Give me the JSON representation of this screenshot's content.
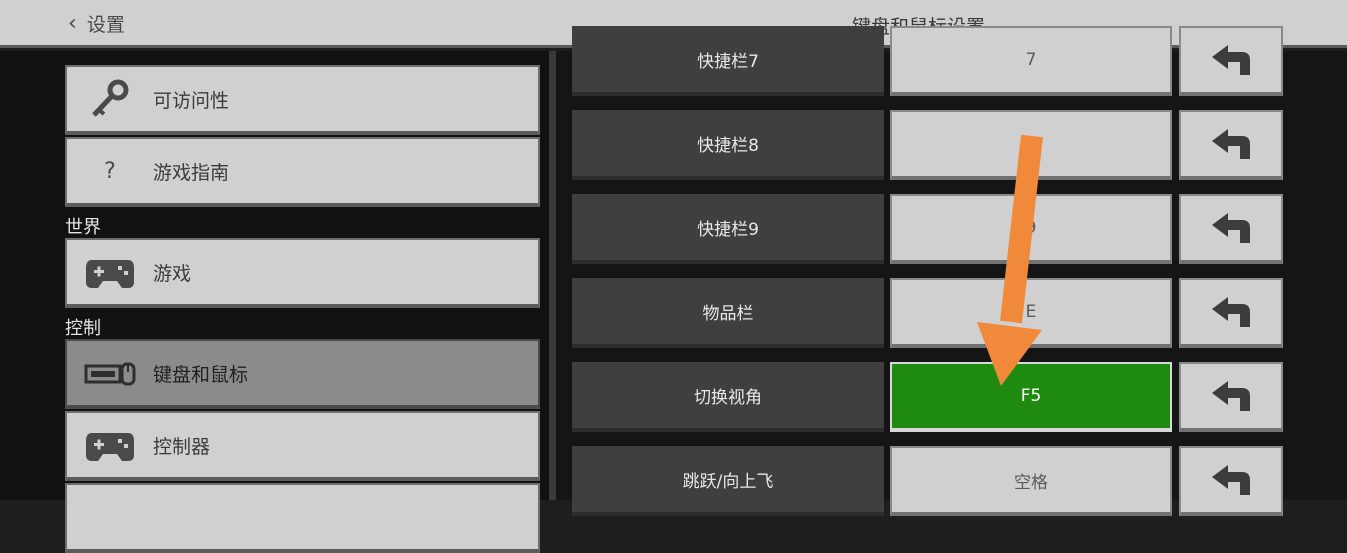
{
  "header": {
    "back_label": "设置",
    "title": "键盘和鼠标设置"
  },
  "sidebar": {
    "sections": [
      "世界",
      "控制"
    ],
    "items": [
      {
        "label": "可访问性",
        "icon": "key-icon"
      },
      {
        "label": "游戏指南",
        "icon": "question-icon",
        "glyph": "?"
      },
      {
        "label": "游戏",
        "icon": "gamepad-icon"
      },
      {
        "label": "键盘和鼠标",
        "icon": "keyboard-mouse-icon",
        "active": true
      },
      {
        "label": "控制器",
        "icon": "gamepad-icon"
      }
    ]
  },
  "bindings": [
    {
      "action": "快捷栏7",
      "key": "7"
    },
    {
      "action": "快捷栏8",
      "key": ""
    },
    {
      "action": "快捷栏9",
      "key": "9"
    },
    {
      "action": "物品栏",
      "key": "E"
    },
    {
      "action": "切换视角",
      "key": "F5",
      "highlighted": true
    },
    {
      "action": "跳跃/向上飞",
      "key": "空格"
    }
  ],
  "colors": {
    "highlight": "#1f8a10",
    "annotation_arrow": "#f08a3a"
  }
}
